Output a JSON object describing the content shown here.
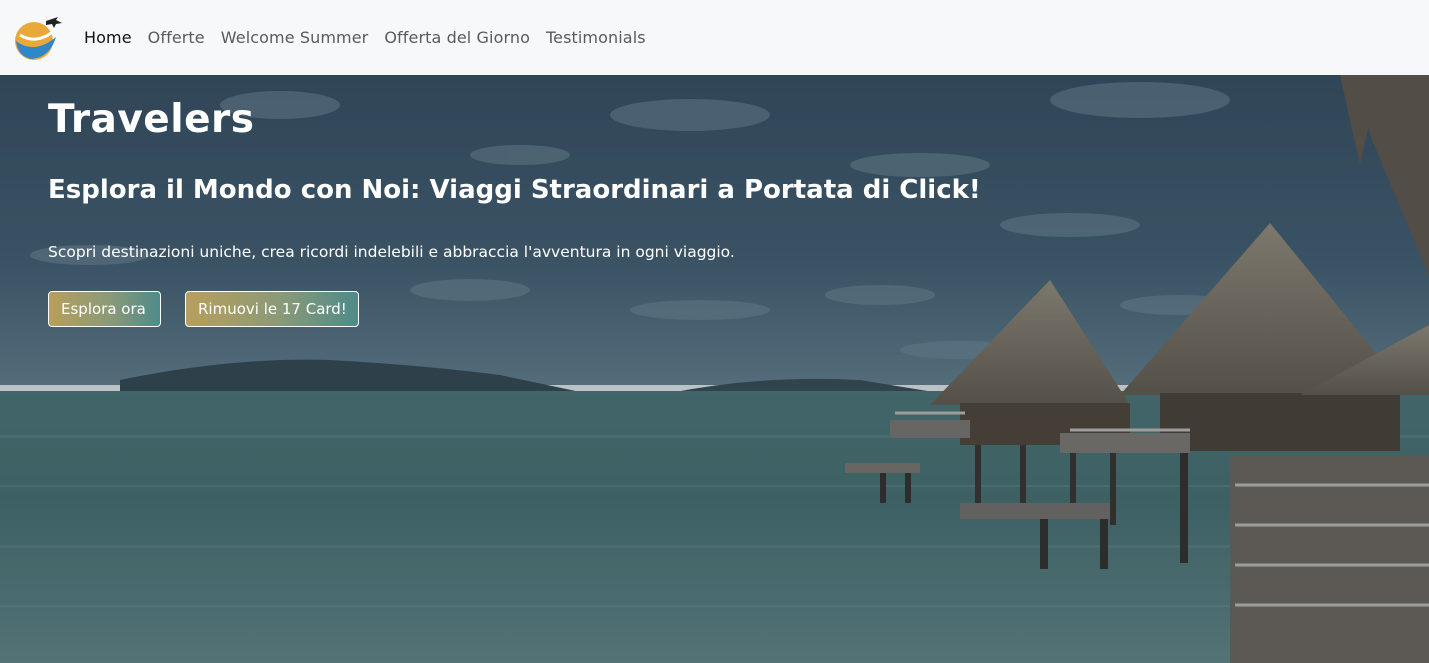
{
  "nav": {
    "items": [
      {
        "label": "Home",
        "active": true
      },
      {
        "label": "Offerte",
        "active": false
      },
      {
        "label": "Welcome Summer",
        "active": false
      },
      {
        "label": "Offerta del Giorno",
        "active": false
      },
      {
        "label": "Testimonials",
        "active": false
      }
    ],
    "logo_icon": "travel-globe-plane-logo"
  },
  "hero": {
    "brand": "Travelers",
    "headline": "Esplora il Mondo con Noi: Viaggi Straordinari a Portata di Click!",
    "subtext": "Scopri destinazioni uniche, crea ricordi indelebili e abbraccia l'avventura in ogni viaggio.",
    "explore_button": "Esplora ora",
    "remove_button": "Rimuovi le 17 Card!",
    "background_icon": "overwater-bungalows-lagoon-photo"
  },
  "colors": {
    "navbar_bg": "#f7f8fa",
    "button_gradient_start": "#b89f5c",
    "button_gradient_end": "#4f8a8a"
  }
}
